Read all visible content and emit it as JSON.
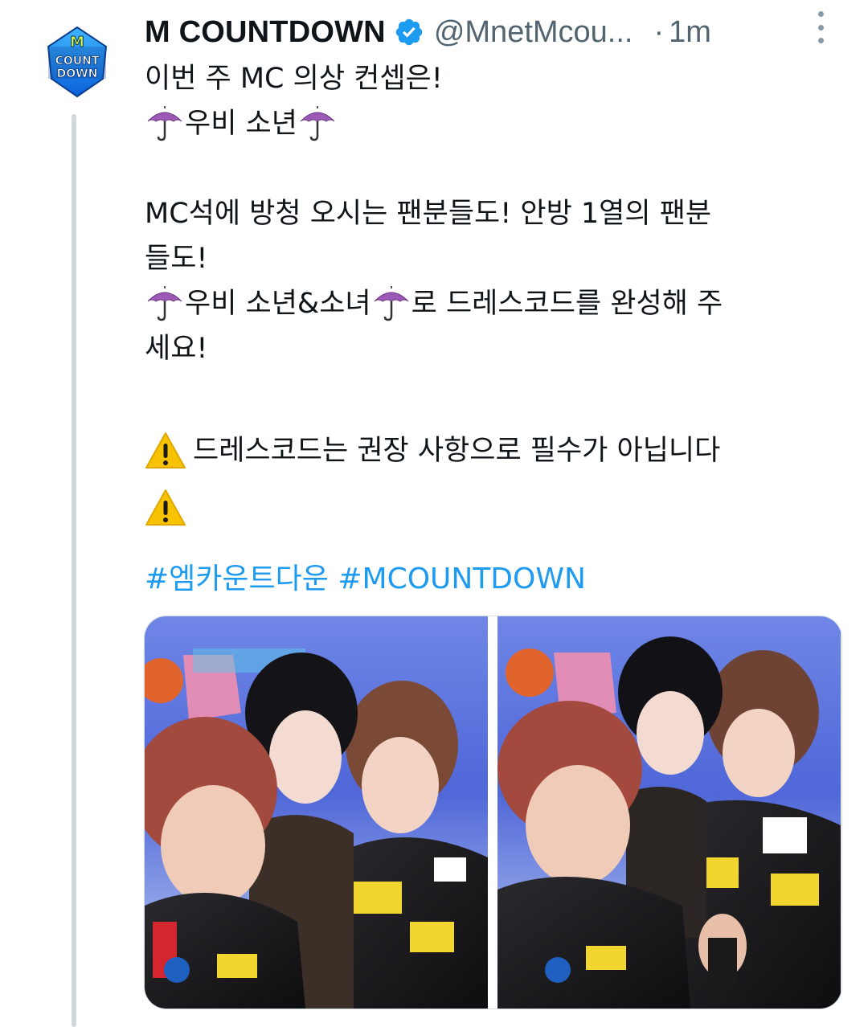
{
  "author": {
    "display_name": "M COUNTDOWN",
    "handle": "@MnetMcou...",
    "time_separator": "·",
    "time": "1m",
    "avatar_icon": "mcountdown-logo-icon",
    "avatar_text": [
      "M",
      "COUNT",
      "DOWN"
    ],
    "verified_icon": "verified-badge-icon",
    "verified_color": "#1d9bf0"
  },
  "tweet": {
    "lines": [
      "이번 주 MC 의상 컨셉은!",
      "우비 소년",
      "MC석에 방청 오시는 팬분들도! 안방 1열의 팬분",
      "들도!",
      "우비 소년&소녀",
      "로 드레스코드를 완성해 주",
      "세요!",
      "드레스코드는 권장 사항으로 필수가 아닙니다"
    ],
    "hashtags": [
      "#엠카운트다운",
      "#MCOUNTDOWN"
    ],
    "hashtag_color": "#1d9bf0"
  },
  "media": {
    "photos": [
      "photo-1",
      "photo-2"
    ]
  },
  "icons": {
    "umbrella": "umbrella-icon",
    "warning": "warning-icon",
    "more": "more-options-icon"
  }
}
